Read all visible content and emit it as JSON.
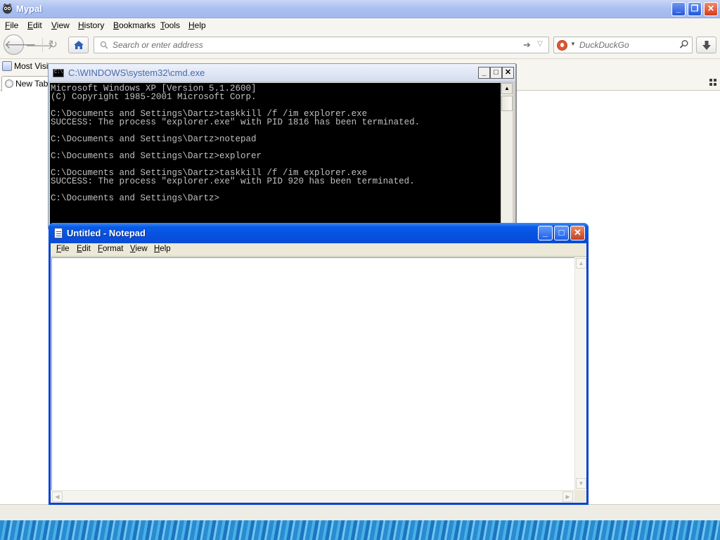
{
  "browser": {
    "title": "Mypal",
    "menu": [
      {
        "label": "File",
        "accel": "F",
        "rest": "ile"
      },
      {
        "label": "Edit",
        "accel": "E",
        "rest": "dit"
      },
      {
        "label": "View",
        "accel": "V",
        "rest": "iew"
      },
      {
        "label": "History",
        "accel": "H",
        "rest": "istory"
      },
      {
        "label": "Bookmarks",
        "accel": "B",
        "rest": "ookmarks"
      },
      {
        "label": "Tools",
        "accel": "T",
        "rest": "ools"
      },
      {
        "label": "Help",
        "accel": "H",
        "rest": "elp"
      }
    ],
    "url_placeholder": "Search or enter address",
    "url_value": "",
    "search_placeholder": "DuckDuckGo",
    "search_value": "",
    "bookmarks": [
      {
        "label": "Most Visi"
      }
    ],
    "tabs": [
      {
        "label": "New Tab"
      }
    ],
    "icons": {
      "logo": "mypal-logo-icon",
      "back": "back-arrow-icon",
      "forward": "forward-arrow-icon",
      "reload": "reload-icon",
      "home": "home-icon",
      "go": "go-arrow-icon",
      "search": "magnifier-icon",
      "download": "download-arrow-icon"
    }
  },
  "cmd": {
    "title": "C:\\WINDOWS\\system32\\cmd.exe",
    "console_text": "Microsoft Windows XP [Version 5.1.2600]\n(C) Copyright 1985-2001 Microsoft Corp.\n\nC:\\Documents and Settings\\Dartz>taskkill /f /im explorer.exe\nSUCCESS: The process \"explorer.exe\" with PID 1816 has been terminated.\n\nC:\\Documents and Settings\\Dartz>notepad\n\nC:\\Documents and Settings\\Dartz>explorer\n\nC:\\Documents and Settings\\Dartz>taskkill /f /im explorer.exe\nSUCCESS: The process \"explorer.exe\" with PID 920 has been terminated.\n\nC:\\Documents and Settings\\Dartz>"
  },
  "notepad": {
    "title": "Untitled - Notepad",
    "menu": [
      {
        "accel": "F",
        "rest": "ile"
      },
      {
        "accel": "E",
        "rest": "dit"
      },
      {
        "accel": "F",
        "rest": "ormat"
      },
      {
        "accel": "V",
        "rest": "iew"
      },
      {
        "accel": "H",
        "rest": "elp"
      }
    ],
    "content": ""
  },
  "colors": {
    "xp_title_blue": "#0551e0",
    "close_red": "#c6401f",
    "console_bg": "#000000",
    "console_fg": "#c0c0c0"
  }
}
